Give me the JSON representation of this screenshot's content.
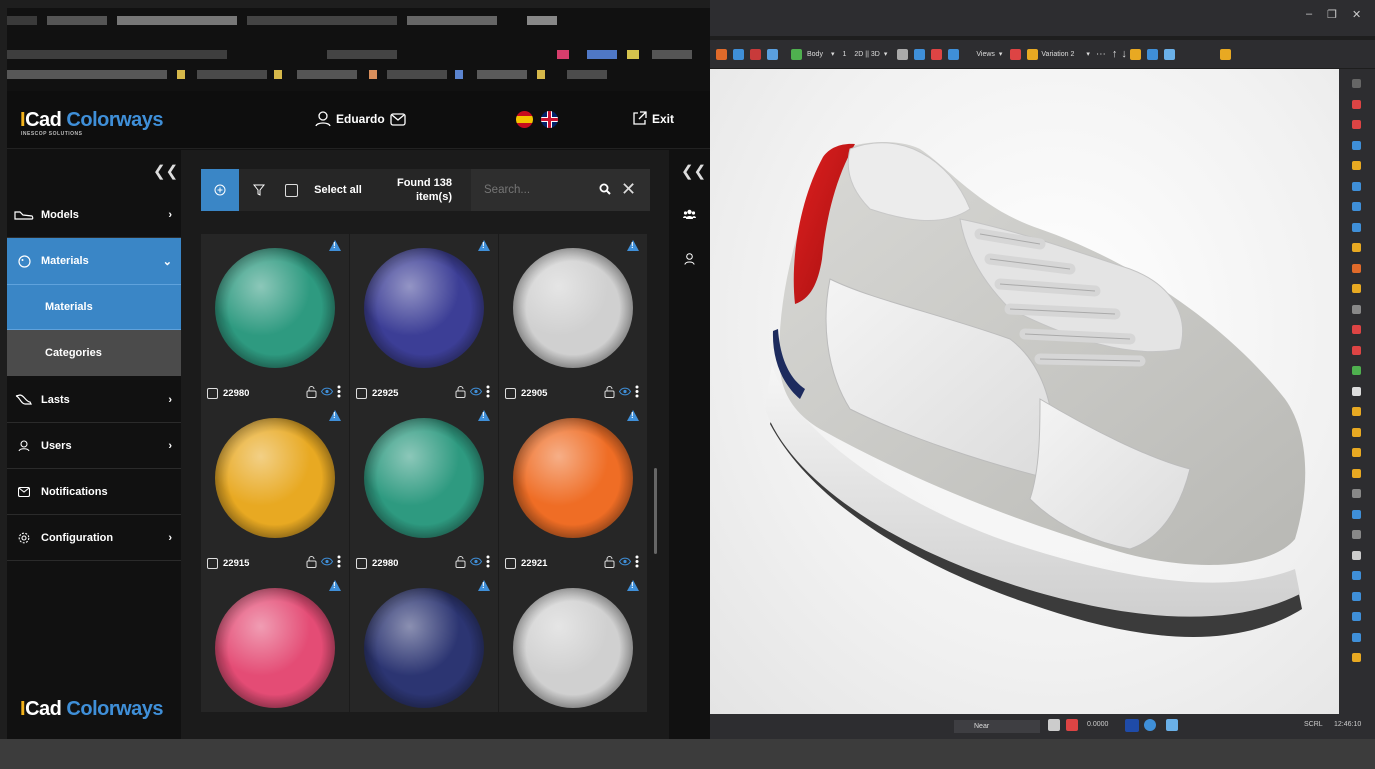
{
  "app": {
    "logo": {
      "part1": "I",
      "part2": "Cad ",
      "part3": "Colorways",
      "tagline": "INESCOP SOLUTIONS"
    },
    "user_name": "Eduardo",
    "exit_label": "Exit",
    "languages": [
      "es",
      "en"
    ]
  },
  "sidebar": {
    "items": [
      {
        "label": "Models",
        "icon": "shoe-icon"
      },
      {
        "label": "Materials",
        "icon": "palette-icon"
      },
      {
        "label": "Lasts",
        "icon": "last-icon"
      },
      {
        "label": "Users",
        "icon": "user-icon"
      },
      {
        "label": "Notifications",
        "icon": "mail-icon"
      },
      {
        "label": "Configuration",
        "icon": "gear-icon"
      }
    ],
    "sub_items": [
      {
        "label": "Materials"
      },
      {
        "label": "Categories"
      }
    ]
  },
  "toolbar": {
    "select_all": "Select all",
    "found_text": "Found 138 item(s)",
    "search_placeholder": "Search..."
  },
  "materials": [
    {
      "code": "22980",
      "color": "#2e9a80"
    },
    {
      "code": "22925",
      "color": "#3c3e96"
    },
    {
      "code": "22905",
      "color": "#d0d0d0"
    },
    {
      "code": "22915",
      "color": "#e8a922"
    },
    {
      "code": "22980",
      "color": "#2e9a80"
    },
    {
      "code": "22921",
      "color": "#ef6d25"
    },
    {
      "code": "",
      "color": "#e44c75"
    },
    {
      "code": "",
      "color": "#2c3572"
    },
    {
      "code": "",
      "color": "#d0d0d0"
    }
  ],
  "viewer": {
    "toolbar": {
      "body_label": "Body",
      "index": "1",
      "mode": "2D || 3D",
      "views_label": "Views",
      "variation_label": "Variation 2"
    },
    "status": {
      "near_label": "Near",
      "value": "0.0000",
      "scrl": "SCRL",
      "time": "12:46:10"
    }
  }
}
